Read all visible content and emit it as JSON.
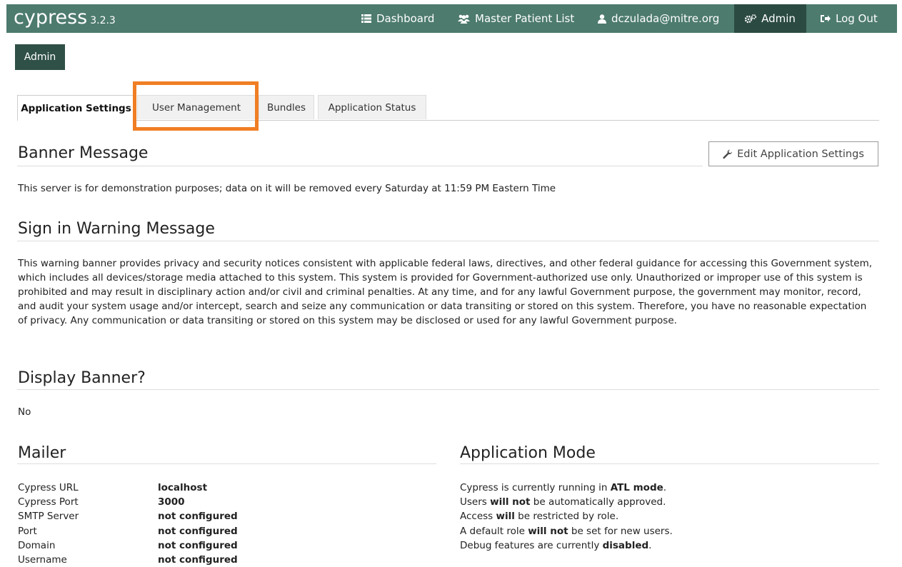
{
  "app": {
    "brand": "cypress",
    "version": "3.2.3"
  },
  "nav": {
    "dashboard": "Dashboard",
    "patients": "Master Patient List",
    "user": "dczulada@mitre.org",
    "admin": "Admin",
    "logout": "Log Out"
  },
  "breadcrumb": "Admin",
  "tabs": {
    "settings": "Application Settings",
    "users": "User Management",
    "bundles": "Bundles",
    "status": "Application Status"
  },
  "banner": {
    "title": "Banner Message",
    "text": "This server is for demonstration purposes; data on it will be removed every Saturday at 11:59 PM Eastern Time"
  },
  "edit_button": "Edit Application Settings",
  "warning": {
    "title": "Sign in Warning Message",
    "text": "This warning banner provides privacy and security notices consistent with applicable federal laws, directives, and other federal guidance for accessing this Government system, which includes all devices/storage media attached to this system. This system is provided for Government-authorized use only. Unauthorized or improper use of this system is prohibited and may result in disciplinary action and/or civil and criminal penalties. At any time, and for any lawful Government purpose, the government may monitor, record, and audit your system usage and/or intercept, search and seize any communication or data transiting or stored on this system. Therefore, you have no reasonable expectation of privacy. Any communication or data transiting or stored on this system may be disclosed or used for any lawful Government purpose."
  },
  "display_banner": {
    "title": "Display Banner?",
    "value": "No"
  },
  "mailer": {
    "title": "Mailer",
    "rows": [
      {
        "label": "Cypress URL",
        "value": "localhost"
      },
      {
        "label": "Cypress Port",
        "value": "3000"
      },
      {
        "label": "SMTP Server",
        "value": "not configured"
      },
      {
        "label": "Port",
        "value": "not configured"
      },
      {
        "label": "Domain",
        "value": "not configured"
      },
      {
        "label": "Username",
        "value": "not configured"
      }
    ]
  },
  "mode": {
    "title": "Application Mode",
    "l1a": "Cypress is currently running in ",
    "l1b": "ATL mode",
    "l1c": ".",
    "l2a": "Users ",
    "l2b": "will not",
    "l2c": " be automatically approved.",
    "l3a": "Access ",
    "l3b": "will",
    "l3c": " be restricted by role.",
    "l4a": "A default role ",
    "l4b": "will not",
    "l4c": " be set for new users.",
    "l5a": "Debug features are currently ",
    "l5b": "disabled",
    "l5c": "."
  },
  "icons": {
    "dashboard": "list-icon",
    "patients": "users-icon",
    "user": "user-icon",
    "admin": "gears-icon",
    "logout": "sign-out-icon",
    "edit": "wrench-icon"
  },
  "colors": {
    "navbar": "#4d7b6e",
    "navbar_active": "#2b4a42",
    "breadcrumb": "#2f5047",
    "highlight": "#f07e24"
  }
}
